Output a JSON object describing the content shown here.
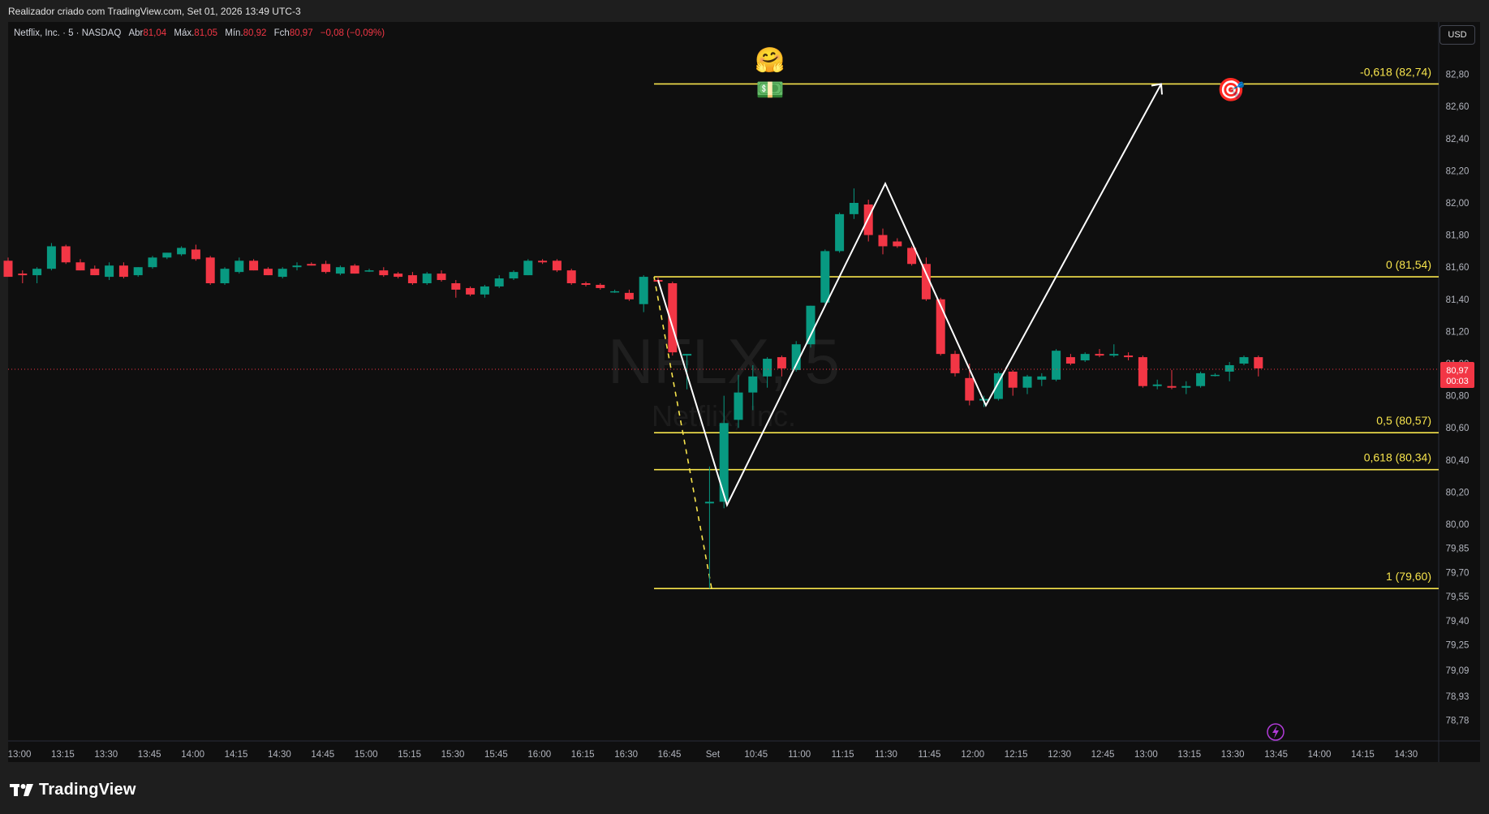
{
  "header": {
    "title": "Realizador criado com TradingView.com, Set 01, 2026 13:49 UTC-3"
  },
  "legend": {
    "symbol": "Netflix, Inc. · 5 · NASDAQ",
    "open_label": "Abr",
    "open": "81,04",
    "high_label": "Máx.",
    "high": "81,05",
    "low_label": "Mín.",
    "low": "80,92",
    "close_label": "Fch",
    "close": "80,97",
    "change": "−0,08 (−0,09%)"
  },
  "currency_button": "USD",
  "watermark": {
    "ticker": "NFLX, 5",
    "name": "Netflix, Inc."
  },
  "footer": {
    "brand": "TradingView"
  },
  "price_tag": {
    "price": "80,97",
    "countdown": "00:03"
  },
  "colors": {
    "up": "#089981",
    "down": "#f23645",
    "fib": "#f7e44c",
    "path": "#ffffff",
    "background": "#0f0f0f"
  },
  "emojis": {
    "hug": "🤗",
    "money": "💵",
    "target": "🎯"
  },
  "chart_data": {
    "type": "candlestick",
    "y_axis_ticks": [
      "82,80",
      "82,60",
      "82,40",
      "82,20",
      "82,00",
      "81,80",
      "81,60",
      "81,40",
      "81,20",
      "81,00",
      "80,80",
      "80,60",
      "80,40",
      "80,20",
      "80,00",
      "79,85",
      "79,70",
      "79,55",
      "79,40",
      "79,25",
      "79,09",
      "78,93",
      "78,78"
    ],
    "x_axis_ticks": [
      "13:00",
      "13:15",
      "13:30",
      "13:45",
      "14:00",
      "14:15",
      "14:30",
      "14:45",
      "15:00",
      "15:15",
      "15:30",
      "15:45",
      "16:00",
      "16:15",
      "16:30",
      "16:45",
      "Set",
      "10:45",
      "11:00",
      "11:15",
      "11:30",
      "11:45",
      "12:00",
      "12:15",
      "12:30",
      "12:45",
      "13:00",
      "13:15",
      "13:30",
      "13:45",
      "14:00",
      "14:15",
      "14:30"
    ],
    "fib_levels": [
      {
        "label": "-0,618 (82,74)",
        "price": 82.74
      },
      {
        "label": "0 (81,54)",
        "price": 81.54
      },
      {
        "label": "0,5 (80,57)",
        "price": 80.57
      },
      {
        "label": "0,618 (80,34)",
        "price": 80.34
      },
      {
        "label": "1 (79,60)",
        "price": 79.6
      }
    ],
    "projection_path": [
      {
        "time": "16:50",
        "price": 81.52
      },
      {
        "time": "10:35",
        "price": 80.1
      },
      {
        "time": "11:30",
        "price": 82.12
      },
      {
        "time": "12:05",
        "price": 80.72
      },
      {
        "time": "13:05",
        "price": 82.74
      }
    ],
    "candles": [
      {
        "o": 81.64,
        "h": 81.66,
        "l": 81.54,
        "c": 81.54
      },
      {
        "o": 81.56,
        "h": 81.58,
        "l": 81.5,
        "c": 81.55
      },
      {
        "o": 81.55,
        "h": 81.6,
        "l": 81.5,
        "c": 81.59
      },
      {
        "o": 81.59,
        "h": 81.75,
        "l": 81.58,
        "c": 81.73
      },
      {
        "o": 81.73,
        "h": 81.74,
        "l": 81.62,
        "c": 81.63
      },
      {
        "o": 81.63,
        "h": 81.65,
        "l": 81.58,
        "c": 81.58
      },
      {
        "o": 81.59,
        "h": 81.61,
        "l": 81.55,
        "c": 81.55
      },
      {
        "o": 81.54,
        "h": 81.63,
        "l": 81.52,
        "c": 81.61
      },
      {
        "o": 81.61,
        "h": 81.63,
        "l": 81.53,
        "c": 81.54
      },
      {
        "o": 81.55,
        "h": 81.6,
        "l": 81.54,
        "c": 81.6
      },
      {
        "o": 81.6,
        "h": 81.67,
        "l": 81.59,
        "c": 81.66
      },
      {
        "o": 81.66,
        "h": 81.69,
        "l": 81.65,
        "c": 81.69
      },
      {
        "o": 81.68,
        "h": 81.73,
        "l": 81.67,
        "c": 81.72
      },
      {
        "o": 81.71,
        "h": 81.74,
        "l": 81.64,
        "c": 81.65
      },
      {
        "o": 81.66,
        "h": 81.67,
        "l": 81.49,
        "c": 81.5
      },
      {
        "o": 81.5,
        "h": 81.6,
        "l": 81.49,
        "c": 81.59
      },
      {
        "o": 81.57,
        "h": 81.66,
        "l": 81.56,
        "c": 81.64
      },
      {
        "o": 81.64,
        "h": 81.65,
        "l": 81.58,
        "c": 81.58
      },
      {
        "o": 81.59,
        "h": 81.6,
        "l": 81.55,
        "c": 81.55
      },
      {
        "o": 81.54,
        "h": 81.6,
        "l": 81.53,
        "c": 81.59
      },
      {
        "o": 81.6,
        "h": 81.63,
        "l": 81.58,
        "c": 81.61
      },
      {
        "o": 81.62,
        "h": 81.63,
        "l": 81.61,
        "c": 81.61
      },
      {
        "o": 81.62,
        "h": 81.64,
        "l": 81.56,
        "c": 81.57
      },
      {
        "o": 81.56,
        "h": 81.61,
        "l": 81.55,
        "c": 81.6
      },
      {
        "o": 81.61,
        "h": 81.62,
        "l": 81.56,
        "c": 81.56
      },
      {
        "o": 81.58,
        "h": 81.59,
        "l": 81.57,
        "c": 81.58
      },
      {
        "o": 81.58,
        "h": 81.6,
        "l": 81.54,
        "c": 81.55
      },
      {
        "o": 81.56,
        "h": 81.57,
        "l": 81.53,
        "c": 81.54
      },
      {
        "o": 81.55,
        "h": 81.57,
        "l": 81.49,
        "c": 81.5
      },
      {
        "o": 81.5,
        "h": 81.57,
        "l": 81.49,
        "c": 81.56
      },
      {
        "o": 81.56,
        "h": 81.58,
        "l": 81.51,
        "c": 81.52
      },
      {
        "o": 81.5,
        "h": 81.52,
        "l": 81.41,
        "c": 81.46
      },
      {
        "o": 81.47,
        "h": 81.48,
        "l": 81.42,
        "c": 81.43
      },
      {
        "o": 81.43,
        "h": 81.49,
        "l": 81.41,
        "c": 81.48
      },
      {
        "o": 81.48,
        "h": 81.55,
        "l": 81.47,
        "c": 81.53
      },
      {
        "o": 81.53,
        "h": 81.58,
        "l": 81.52,
        "c": 81.57
      },
      {
        "o": 81.55,
        "h": 81.65,
        "l": 81.55,
        "c": 81.64
      },
      {
        "o": 81.64,
        "h": 81.65,
        "l": 81.62,
        "c": 81.63
      },
      {
        "o": 81.64,
        "h": 81.65,
        "l": 81.57,
        "c": 81.58
      },
      {
        "o": 81.58,
        "h": 81.59,
        "l": 81.49,
        "c": 81.5
      },
      {
        "o": 81.5,
        "h": 81.51,
        "l": 81.48,
        "c": 81.49
      },
      {
        "o": 81.49,
        "h": 81.5,
        "l": 81.46,
        "c": 81.47
      },
      {
        "o": 81.45,
        "h": 81.46,
        "l": 81.44,
        "c": 81.45
      },
      {
        "o": 81.44,
        "h": 81.46,
        "l": 81.39,
        "c": 81.4
      },
      {
        "o": 81.37,
        "h": 81.55,
        "l": 81.32,
        "c": 81.54
      },
      {
        "o": 81.52,
        "h": 81.54,
        "l": 81.5,
        "c": 81.51
      },
      {
        "o": 81.5,
        "h": 81.51,
        "l": 81.05,
        "c": 81.07
      },
      {
        "o": 81.05,
        "h": 81.06,
        "l": 80.84,
        "c": 81.06
      },
      {
        "o": 80.13,
        "h": 80.36,
        "l": 79.6,
        "c": 80.14
      },
      {
        "o": 80.14,
        "h": 80.8,
        "l": 80.1,
        "c": 80.63
      },
      {
        "o": 80.65,
        "h": 80.93,
        "l": 80.6,
        "c": 80.82
      },
      {
        "o": 80.82,
        "h": 80.99,
        "l": 80.71,
        "c": 80.92
      },
      {
        "o": 80.92,
        "h": 81.04,
        "l": 80.85,
        "c": 81.03
      },
      {
        "o": 81.04,
        "h": 81.05,
        "l": 80.92,
        "c": 80.97
      },
      {
        "o": 80.96,
        "h": 81.14,
        "l": 80.95,
        "c": 81.12
      },
      {
        "o": 81.12,
        "h": 81.36,
        "l": 81.1,
        "c": 81.36
      },
      {
        "o": 81.38,
        "h": 81.71,
        "l": 81.36,
        "c": 81.7
      },
      {
        "o": 81.7,
        "h": 81.94,
        "l": 81.69,
        "c": 81.93
      },
      {
        "o": 81.93,
        "h": 82.09,
        "l": 81.9,
        "c": 82.0
      },
      {
        "o": 81.99,
        "h": 82.02,
        "l": 81.76,
        "c": 81.8
      },
      {
        "o": 81.8,
        "h": 81.84,
        "l": 81.68,
        "c": 81.73
      },
      {
        "o": 81.76,
        "h": 81.78,
        "l": 81.72,
        "c": 81.73
      },
      {
        "o": 81.72,
        "h": 81.73,
        "l": 81.61,
        "c": 81.62
      },
      {
        "o": 81.62,
        "h": 81.66,
        "l": 81.39,
        "c": 81.4
      },
      {
        "o": 81.4,
        "h": 81.41,
        "l": 81.05,
        "c": 81.06
      },
      {
        "o": 81.06,
        "h": 81.08,
        "l": 80.92,
        "c": 80.94
      },
      {
        "o": 80.91,
        "h": 81.0,
        "l": 80.74,
        "c": 80.77
      },
      {
        "o": 80.77,
        "h": 80.8,
        "l": 80.73,
        "c": 80.78
      },
      {
        "o": 80.78,
        "h": 80.95,
        "l": 80.77,
        "c": 80.94
      },
      {
        "o": 80.95,
        "h": 80.96,
        "l": 80.8,
        "c": 80.85
      },
      {
        "o": 80.85,
        "h": 80.93,
        "l": 80.81,
        "c": 80.92
      },
      {
        "o": 80.9,
        "h": 80.94,
        "l": 80.86,
        "c": 80.92
      },
      {
        "o": 80.9,
        "h": 81.09,
        "l": 80.89,
        "c": 81.08
      },
      {
        "o": 81.04,
        "h": 81.06,
        "l": 80.99,
        "c": 81.0
      },
      {
        "o": 81.02,
        "h": 81.07,
        "l": 81.01,
        "c": 81.06
      },
      {
        "o": 81.06,
        "h": 81.09,
        "l": 81.04,
        "c": 81.05
      },
      {
        "o": 81.05,
        "h": 81.12,
        "l": 81.04,
        "c": 81.06
      },
      {
        "o": 81.05,
        "h": 81.07,
        "l": 81.02,
        "c": 81.04
      },
      {
        "o": 81.04,
        "h": 81.05,
        "l": 80.85,
        "c": 80.86
      },
      {
        "o": 80.86,
        "h": 80.9,
        "l": 80.84,
        "c": 80.87
      },
      {
        "o": 80.86,
        "h": 80.96,
        "l": 80.84,
        "c": 80.85
      },
      {
        "o": 80.85,
        "h": 80.89,
        "l": 80.81,
        "c": 80.86
      },
      {
        "o": 80.86,
        "h": 80.95,
        "l": 80.85,
        "c": 80.94
      },
      {
        "o": 80.93,
        "h": 80.94,
        "l": 80.92,
        "c": 80.93
      },
      {
        "o": 80.95,
        "h": 81.01,
        "l": 80.89,
        "c": 80.99
      },
      {
        "o": 81.0,
        "h": 81.05,
        "l": 80.99,
        "c": 81.04
      },
      {
        "o": 81.04,
        "h": 81.05,
        "l": 80.92,
        "c": 80.97
      }
    ]
  }
}
